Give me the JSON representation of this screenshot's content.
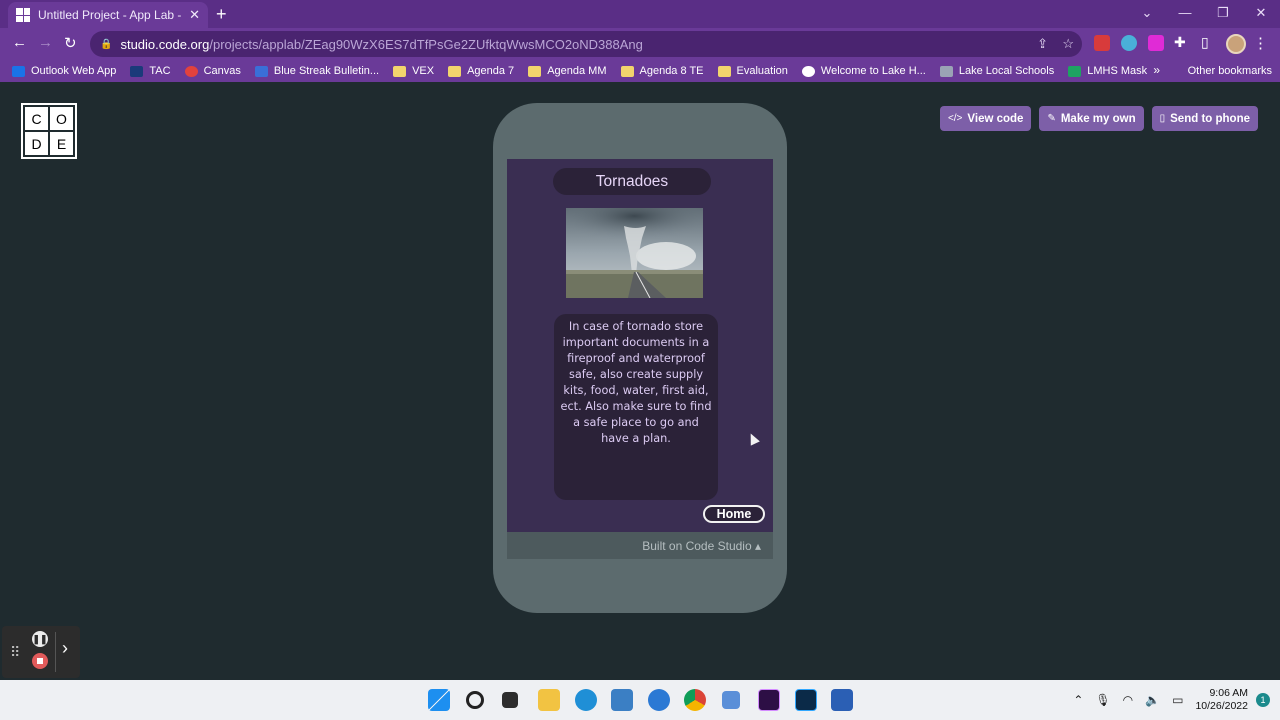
{
  "browser": {
    "tab_title": "Untitled Project - App Lab - Code",
    "url_host": "studio.code.org",
    "url_path": "/projects/applab/ZEag90WzX6ES7dTfPsGe2ZUfktqWwsMCO2oND388Ang"
  },
  "bookmarks": {
    "items": [
      {
        "label": "Outlook Web App"
      },
      {
        "label": "TAC"
      },
      {
        "label": "Canvas"
      },
      {
        "label": "Blue Streak Bulletin..."
      },
      {
        "label": "VEX"
      },
      {
        "label": "Agenda 7"
      },
      {
        "label": "Agenda MM"
      },
      {
        "label": "Agenda 8 TE"
      },
      {
        "label": "Evaluation"
      },
      {
        "label": "Welcome to Lake H..."
      },
      {
        "label": "Lake Local Schools"
      },
      {
        "label": "LMHS Mask"
      }
    ],
    "more": "»",
    "other": "Other bookmarks"
  },
  "logo": [
    "C",
    "O",
    "D",
    "E"
  ],
  "header_buttons": {
    "view_code": "View code",
    "make_my_own": "Make my own",
    "send_to_phone": "Send to phone"
  },
  "app": {
    "title": "Tornadoes",
    "body": "In case of tornado store important documents in a fireproof and waterproof safe, also create supply kits, food, water, first aid, ect. Also make sure to find a safe place to go and have a plan.",
    "home_button": "Home",
    "built_on": "Built on Code Studio ▴"
  },
  "taskbar": {
    "time": "9:06 AM",
    "date": "10/26/2022",
    "notifications": "1"
  },
  "colors": {
    "accent_purple": "#6a3a98",
    "app_background": "#3a2e52",
    "phone_frame": "#5c6b6e"
  }
}
